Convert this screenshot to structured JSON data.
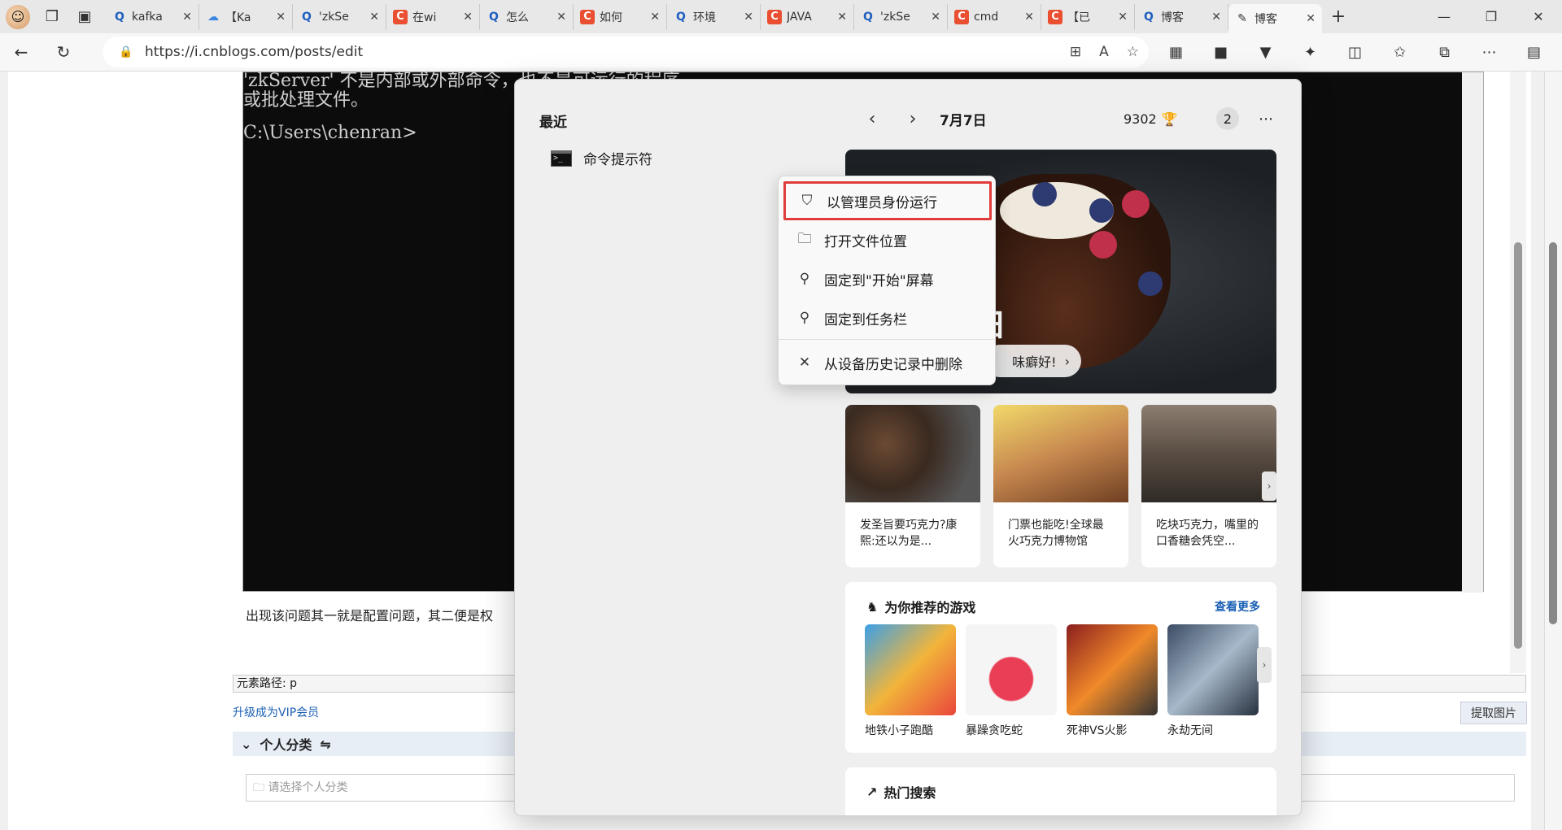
{
  "browser": {
    "tabs": [
      {
        "icon": "search",
        "label": "kafka"
      },
      {
        "icon": "cloud",
        "label": "【Ka"
      },
      {
        "icon": "search",
        "label": "'zkSe"
      },
      {
        "icon": "csdn",
        "label": "在wi"
      },
      {
        "icon": "search",
        "label": "怎么"
      },
      {
        "icon": "csdn",
        "label": "如何"
      },
      {
        "icon": "search",
        "label": "环境"
      },
      {
        "icon": "csdn",
        "label": "JAVA"
      },
      {
        "icon": "search",
        "label": "'zkSe"
      },
      {
        "icon": "csdn",
        "label": "cmd"
      },
      {
        "icon": "csdn",
        "label": "【已"
      },
      {
        "icon": "search",
        "label": "博客"
      },
      {
        "icon": "cnblogs",
        "label": "博客"
      }
    ],
    "url": "https://i.cnblogs.com/posts/edit"
  },
  "console": {
    "line1": "'zkServer' 不是内部或外部命令，也不是可运行的程序",
    "line2": "或批处理文件。",
    "line3": "C:\\Users\\chenran>"
  },
  "editor": {
    "paragraph": "出现该问题其一就是配置问题，其二便是权",
    "element_path": "元素路径: p",
    "vip_link": "升级成为VIP会员",
    "extract_button": "提取图片",
    "category_title": "个人分类",
    "category_placeholder": "请选择个人分类"
  },
  "startmenu": {
    "recent_title": "最近",
    "recent_item": "命令提示符",
    "date": "7月7日",
    "points": "9302",
    "badge": "2",
    "hero_title": "日",
    "hero_pill": "味癖好!",
    "news": [
      "发圣旨要巧克力?康熙:还以为是...",
      "门票也能吃!全球最火巧克力博物馆",
      "吃块巧克力，嘴里的口香糖会凭空..."
    ],
    "games_title": "为你推荐的游戏",
    "games_see_more": "查看更多",
    "games": [
      "地铁小子跑酷",
      "暴躁贪吃蛇",
      "死神VS火影",
      "永劫无间"
    ],
    "hot_title": "热门搜索"
  },
  "context_menu": {
    "items": [
      {
        "label": "以管理员身份运行",
        "icon": "shield-icon"
      },
      {
        "label": "打开文件位置",
        "icon": "folder-icon"
      },
      {
        "label": "固定到\"开始\"屏幕",
        "icon": "pin-icon"
      },
      {
        "label": "固定到任务栏",
        "icon": "pin-icon"
      },
      {
        "label": "从设备历史记录中删除",
        "icon": "close-icon"
      }
    ]
  },
  "colors": {
    "highlight": "#e03c3c",
    "link": "#1a5fb4",
    "console_bg": "#0c0c0c"
  }
}
